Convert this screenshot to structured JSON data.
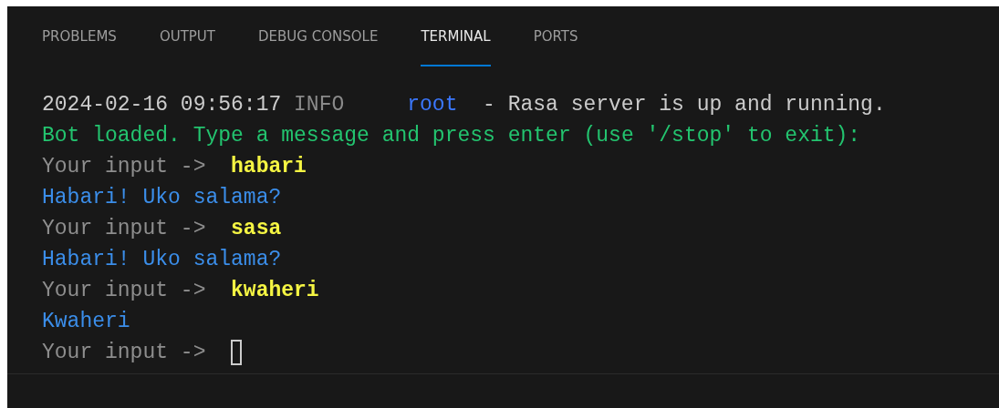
{
  "tabs": [
    {
      "label": "PROBLEMS",
      "selected": false
    },
    {
      "label": "OUTPUT",
      "selected": false
    },
    {
      "label": "DEBUG CONSOLE",
      "selected": false
    },
    {
      "label": "TERMINAL",
      "selected": true
    },
    {
      "label": "PORTS",
      "selected": false
    }
  ],
  "terminal": {
    "lines": [
      {
        "segments": [
          {
            "kind": "timestamp",
            "text": "2024-02-16 09:56:17"
          },
          {
            "kind": "loglevel",
            "text": "INFO"
          },
          {
            "kind": "logger",
            "text": "root"
          },
          {
            "kind": "plain",
            "text": "- Rasa server is up and running."
          }
        ]
      },
      {
        "segments": [
          {
            "kind": "notice",
            "text": "Bot loaded. Type a message and press enter (use '/stop' to exit):"
          }
        ]
      },
      {
        "segments": [
          {
            "kind": "prompt",
            "text": "Your input ->"
          },
          {
            "kind": "user",
            "text": "habari"
          }
        ]
      },
      {
        "segments": [
          {
            "kind": "bot",
            "text": "Habari! Uko salama?"
          }
        ]
      },
      {
        "segments": [
          {
            "kind": "prompt",
            "text": "Your input ->"
          },
          {
            "kind": "user",
            "text": "sasa"
          }
        ]
      },
      {
        "segments": [
          {
            "kind": "bot",
            "text": "Habari! Uko salama?"
          }
        ]
      },
      {
        "segments": [
          {
            "kind": "prompt",
            "text": "Your input ->"
          },
          {
            "kind": "user",
            "text": "kwaheri"
          }
        ]
      },
      {
        "segments": [
          {
            "kind": "bot",
            "text": "Kwaheri"
          }
        ]
      },
      {
        "segments": [
          {
            "kind": "prompt",
            "text": "Your input ->"
          },
          {
            "kind": "cursor"
          }
        ]
      }
    ]
  }
}
